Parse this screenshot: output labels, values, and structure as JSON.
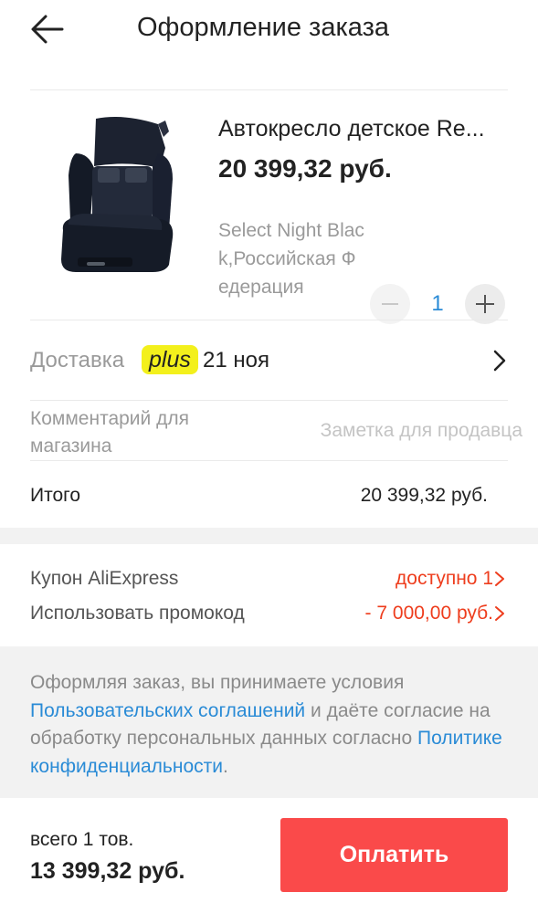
{
  "header": {
    "title": "Оформление заказа",
    "back_icon": "arrow-left-icon"
  },
  "product": {
    "name": "Автокресло детское Re...",
    "price": "20 399,32 руб.",
    "variant": "Select Night Black,Российская Федерация",
    "quantity": "1",
    "image_icon": "car-seat-image"
  },
  "delivery": {
    "label": "Доставка",
    "badge": "plus",
    "date": "21 ноя",
    "chevron_icon": "chevron-right-icon"
  },
  "comment": {
    "label": "Комментарий для магазина",
    "placeholder": "Заметка для продавца",
    "value": ""
  },
  "total": {
    "label": "Итого",
    "value": "20 399,32 руб."
  },
  "coupons": {
    "aliexpress_label": "Купон AliExpress",
    "aliexpress_value": "доступно 1",
    "promo_label": "Использовать промокод",
    "promo_value": "- 7 000,00 руб."
  },
  "terms": {
    "part1": "Оформляя заказ, вы принимаете условия ",
    "link1": "Пользовательских соглашений",
    "part2": " и даёте согласие на обработку персональных данных согласно ",
    "link2": "Политике конфиденциальности",
    "part3": "."
  },
  "footer": {
    "count": "всего 1 тов.",
    "total": "13 399,32 руб.",
    "pay_label": "Оплатить"
  },
  "colors": {
    "accent_red": "#fa4a4a",
    "link_blue": "#2a8bd6",
    "discount_red": "#ee3d1d",
    "plus_yellow": "#f3f01c"
  }
}
